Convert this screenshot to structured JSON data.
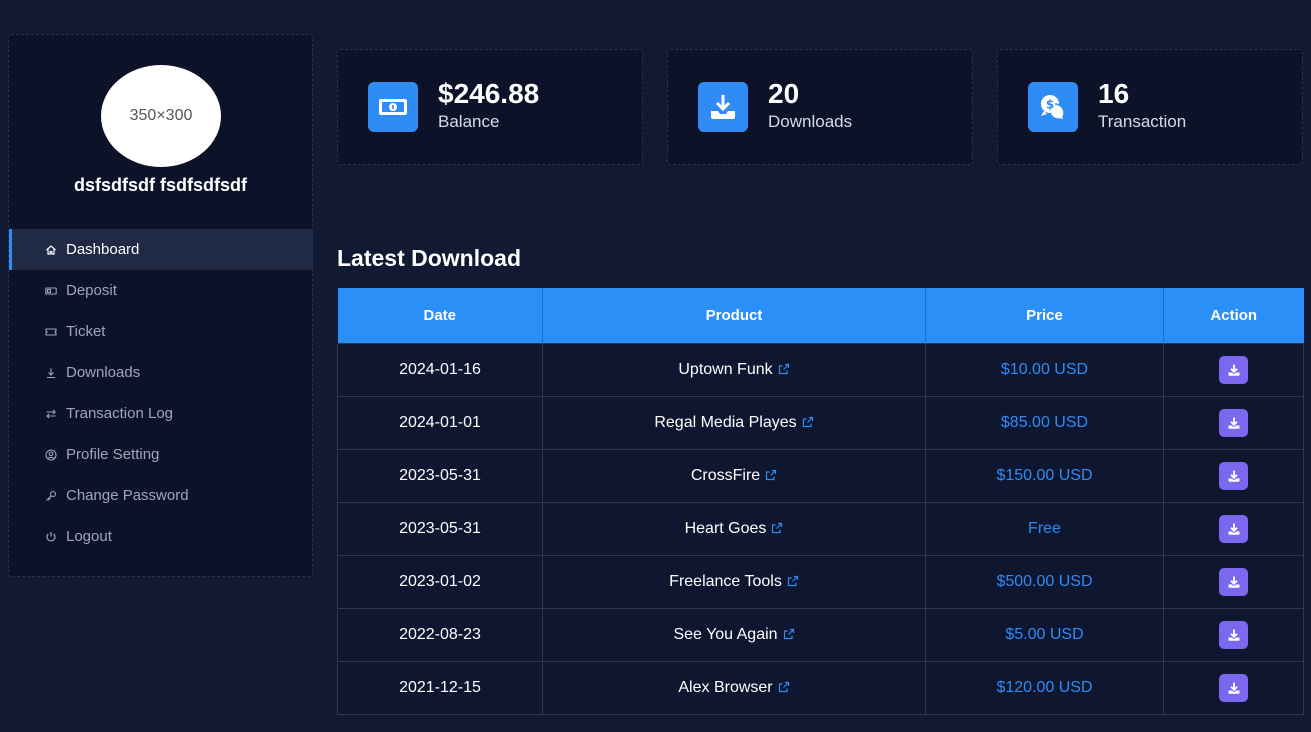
{
  "profile": {
    "avatar_text": "350×300",
    "name": "dsfsdfsdf fsdfsdfsdf"
  },
  "sidebar": {
    "items": [
      {
        "label": "Dashboard",
        "icon": "home-icon",
        "active": true
      },
      {
        "label": "Deposit",
        "icon": "money-icon",
        "active": false
      },
      {
        "label": "Ticket",
        "icon": "ticket-icon",
        "active": false
      },
      {
        "label": "Downloads",
        "icon": "download-icon",
        "active": false
      },
      {
        "label": "Transaction Log",
        "icon": "transfer-icon",
        "active": false
      },
      {
        "label": "Profile Setting",
        "icon": "user-circle-icon",
        "active": false
      },
      {
        "label": "Change Password",
        "icon": "key-icon",
        "active": false
      },
      {
        "label": "Logout",
        "icon": "power-icon",
        "active": false
      }
    ]
  },
  "stats": [
    {
      "value": "$246.88",
      "label": "Balance",
      "icon": "banknote-icon"
    },
    {
      "value": "20",
      "label": "Downloads",
      "icon": "download-tray-icon"
    },
    {
      "value": "16",
      "label": "Transaction",
      "icon": "chat-dollar-icon"
    }
  ],
  "latest_download": {
    "title": "Latest Download",
    "columns": [
      "Date",
      "Product",
      "Price",
      "Action"
    ],
    "rows": [
      {
        "date": "2024-01-16",
        "product": "Uptown Funk",
        "price": "$10.00 USD"
      },
      {
        "date": "2024-01-01",
        "product": "Regal Media Playes",
        "price": "$85.00 USD"
      },
      {
        "date": "2023-05-31",
        "product": "CrossFire",
        "price": "$150.00 USD"
      },
      {
        "date": "2023-05-31",
        "product": "Heart Goes",
        "price": "Free"
      },
      {
        "date": "2023-01-02",
        "product": "Freelance Tools",
        "price": "$500.00 USD"
      },
      {
        "date": "2022-08-23",
        "product": "See You Again",
        "price": "$5.00 USD"
      },
      {
        "date": "2021-12-15",
        "product": "Alex Browser",
        "price": "$120.00 USD"
      }
    ]
  },
  "colors": {
    "background": "#121a33",
    "panel": "#0c1329",
    "accent": "#2f8cf5",
    "action_button": "#7b68ee"
  }
}
